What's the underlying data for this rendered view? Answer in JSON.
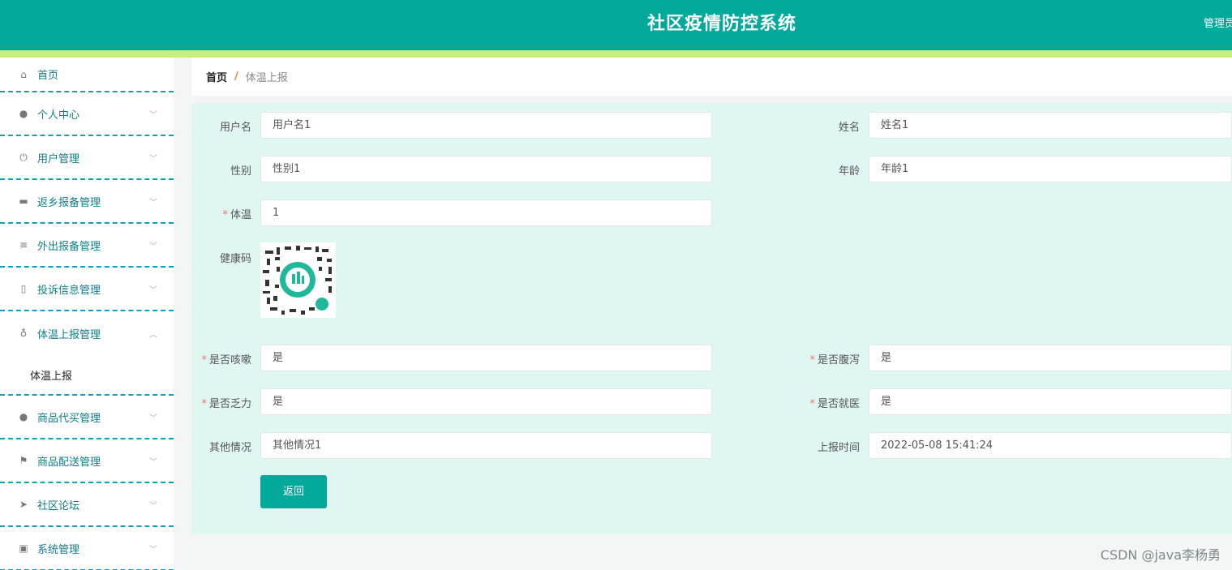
{
  "header": {
    "title": "社区疫情防控系统",
    "user": "管理员"
  },
  "sidebar": {
    "items": [
      {
        "label": "首页",
        "icon": "home-icon",
        "glyph": "⌂"
      },
      {
        "label": "个人中心",
        "icon": "user-icon",
        "glyph": "●"
      },
      {
        "label": "用户管理",
        "icon": "power-icon",
        "glyph": "⏻"
      },
      {
        "label": "返乡报备管理",
        "icon": "chat-icon",
        "glyph": "▬"
      },
      {
        "label": "外出报备管理",
        "icon": "menu-icon",
        "glyph": "≡"
      },
      {
        "label": "投诉信息管理",
        "icon": "microphone-icon",
        "glyph": "▯"
      },
      {
        "label": "体温上报管理",
        "icon": "microphone-icon",
        "glyph": "♁"
      },
      {
        "label": "商品代买管理",
        "icon": "user-icon",
        "glyph": "●"
      },
      {
        "label": "商品配送管理",
        "icon": "flag-icon",
        "glyph": "⚑"
      },
      {
        "label": "社区论坛",
        "icon": "send-icon",
        "glyph": "➤"
      },
      {
        "label": "系统管理",
        "icon": "chart-icon",
        "glyph": "▣"
      }
    ],
    "subitem": "体温上报"
  },
  "breadcrumb": {
    "home": "首页",
    "sep": "/",
    "current": "体温上报"
  },
  "form": {
    "username": {
      "label": "用户名",
      "value": "用户名1"
    },
    "name": {
      "label": "姓名",
      "value": "姓名1"
    },
    "gender": {
      "label": "性别",
      "value": "性别1"
    },
    "age": {
      "label": "年龄",
      "value": "年龄1"
    },
    "temperature": {
      "label": "体温",
      "value": "1"
    },
    "health_code": {
      "label": "健康码"
    },
    "cough": {
      "label": "是否咳嗽",
      "value": "是"
    },
    "diarrhea": {
      "label": "是否腹泻",
      "value": "是"
    },
    "fatigue": {
      "label": "是否乏力",
      "value": "是"
    },
    "hospital": {
      "label": "是否就医",
      "value": "是"
    },
    "other": {
      "label": "其他情况",
      "value": "其他情况1"
    },
    "report_time": {
      "label": "上报时间",
      "value": "2022-05-08 15:41:24"
    },
    "back_label": "返回",
    "required_mark": "*"
  },
  "watermark": "CSDN @java李杨勇",
  "colors": {
    "primary": "#00a99a",
    "stripe": "#c8ef7d",
    "panel": "#e0f6f1",
    "required": "#f56c6c"
  }
}
